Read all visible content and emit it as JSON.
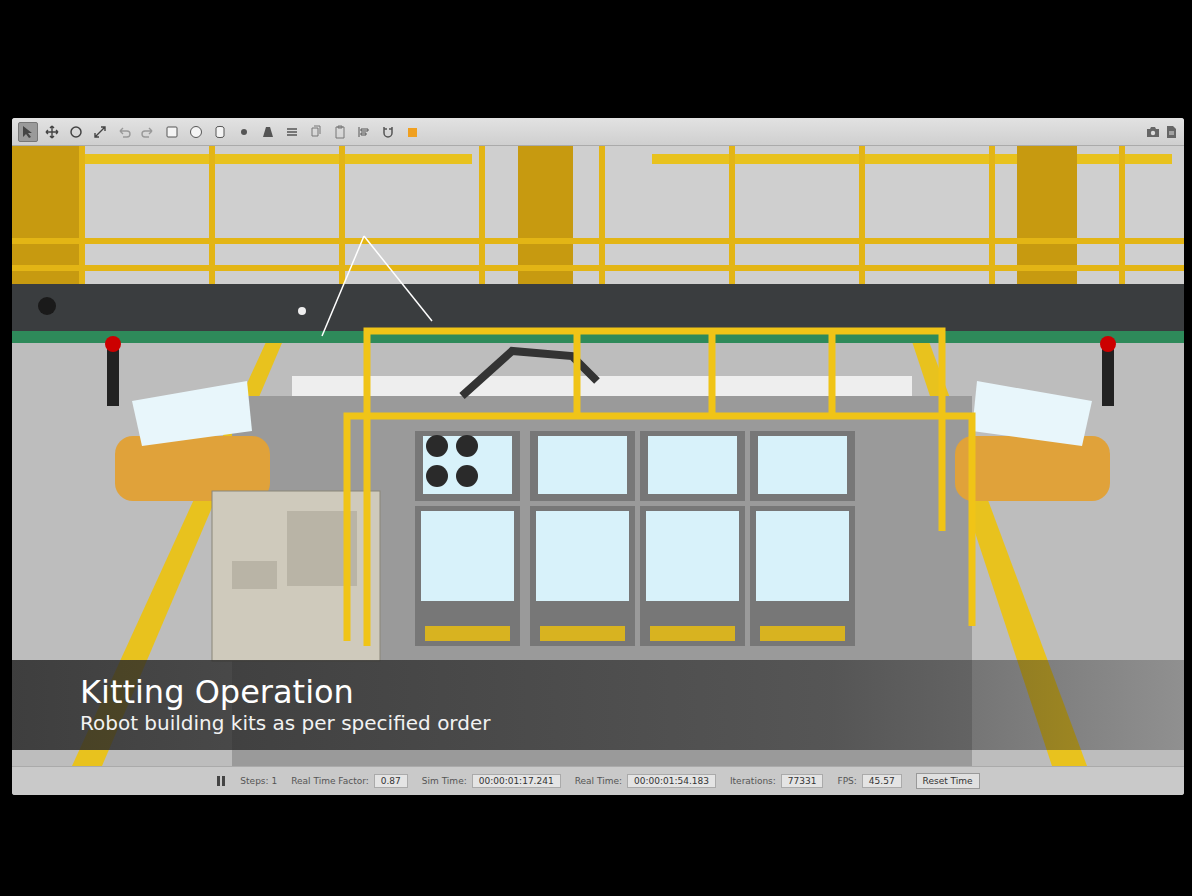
{
  "caption": {
    "title": "Kitting Operation",
    "subtitle": "Robot building kits as per specified order"
  },
  "toolbar": {
    "tools": [
      {
        "kind": "select",
        "selected": true
      },
      {
        "kind": "translate",
        "selected": false
      },
      {
        "kind": "rotate",
        "selected": false
      },
      {
        "kind": "scale",
        "selected": false
      },
      {
        "kind": "undo",
        "selected": false
      },
      {
        "kind": "redo",
        "selected": false
      },
      {
        "kind": "box",
        "selected": false
      },
      {
        "kind": "sphere",
        "selected": false
      },
      {
        "kind": "cylinder",
        "selected": false
      },
      {
        "kind": "pointlight",
        "selected": false
      },
      {
        "kind": "spotlight",
        "selected": false
      },
      {
        "kind": "dirlight",
        "selected": false
      },
      {
        "kind": "copy",
        "selected": false
      },
      {
        "kind": "paste",
        "selected": false
      },
      {
        "kind": "align",
        "selected": false
      },
      {
        "kind": "snap",
        "selected": false
      },
      {
        "kind": "record",
        "selected": false
      }
    ]
  },
  "status_bar": {
    "playing": true,
    "steps": "Steps: 1",
    "fields": [
      {
        "label": "Real Time Factor:",
        "value": "0.87"
      },
      {
        "label": "Sim Time:",
        "value": "00:00:01:17.241"
      },
      {
        "label": "Real Time:",
        "value": "00:00:01:54.183"
      },
      {
        "label": "Iterations:",
        "value": "77331"
      },
      {
        "label": "FPS:",
        "value": "45.57"
      }
    ],
    "reset": "Reset Time"
  }
}
